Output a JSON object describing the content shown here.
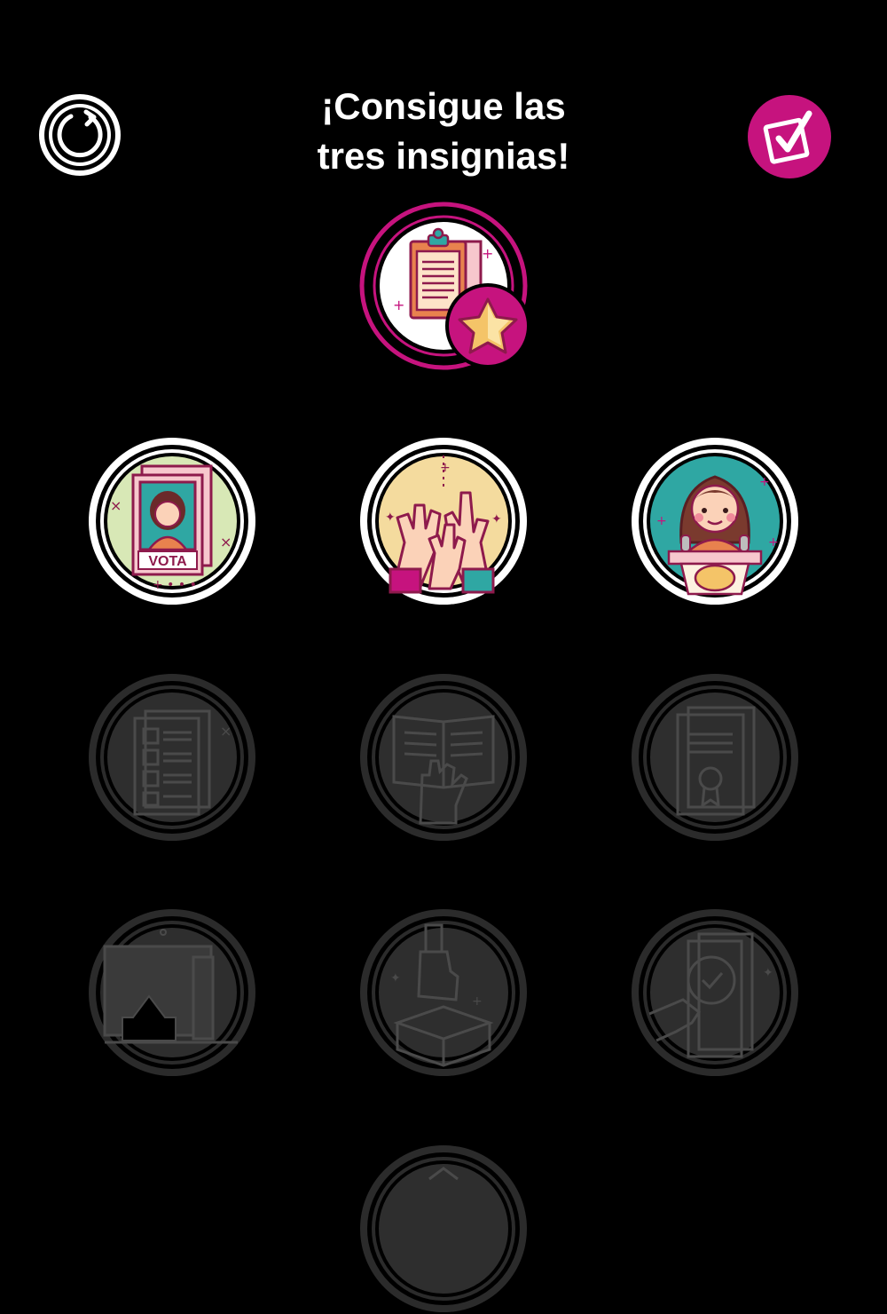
{
  "header": {
    "title_line1": "¡Consigue las",
    "title_line2": "tres insignias!",
    "refresh_icon": "refresh-icon",
    "checklist_icon": "checkbox-check-icon"
  },
  "hero_badge": {
    "icon": "clipboard-star-icon"
  },
  "badge_grid": {
    "items": [
      {
        "icon": "vote-poster-icon",
        "poster_text": "VOTA",
        "state": "unlocked"
      },
      {
        "icon": "raised-hands-icon",
        "state": "unlocked"
      },
      {
        "icon": "candidate-podium-icon",
        "state": "unlocked"
      },
      {
        "icon": "voter-list-icon",
        "state": "locked"
      },
      {
        "icon": "oath-book-icon",
        "state": "locked"
      },
      {
        "icon": "certificate-icon",
        "state": "locked"
      },
      {
        "icon": "building-icon",
        "state": "locked"
      },
      {
        "icon": "ballot-box-icon",
        "state": "locked"
      },
      {
        "icon": "verify-document-icon",
        "state": "locked"
      },
      {
        "icon": "badge-partial-icon",
        "state": "locked"
      }
    ]
  },
  "colors": {
    "accent": "#C6137E",
    "background": "#000000",
    "locked_fill": "#2B2B2B",
    "locked_stroke": "#4A4A4A"
  }
}
